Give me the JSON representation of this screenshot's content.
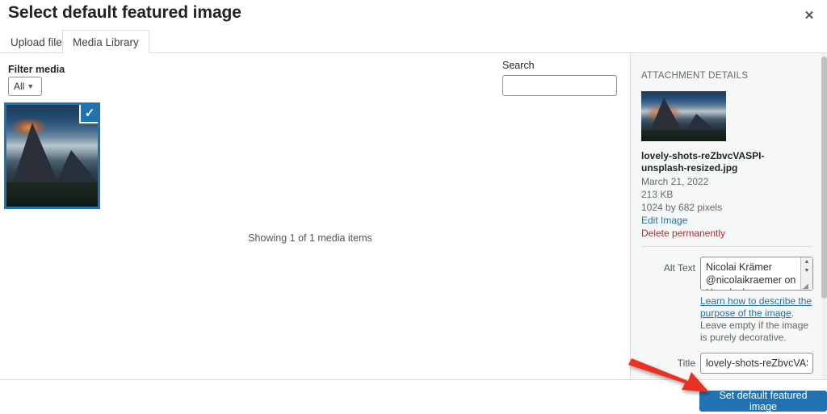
{
  "modal": {
    "title": "Select default featured image",
    "close_icon": "close-icon"
  },
  "tabs": [
    {
      "label": "Upload files",
      "active": false
    },
    {
      "label": "Media Library",
      "active": true
    }
  ],
  "toolbar": {
    "filter_label": "Filter media",
    "filter_value": "All",
    "filter_options": [
      "All"
    ],
    "search_label": "Search",
    "search_value": "",
    "search_placeholder": ""
  },
  "grid": {
    "status_text": "Showing 1 of 1 media items",
    "item": {
      "selected": true,
      "check_icon": "check-icon"
    }
  },
  "sidebar": {
    "heading": "ATTACHMENT DETAILS",
    "filename": "lovely-shots-reZbvcVASPI-unsplash-resized.jpg",
    "date": "March 21, 2022",
    "filesize": "213 KB",
    "dimensions": "1024 by 682 pixels",
    "edit_link": "Edit Image",
    "delete_link": "Delete permanently",
    "alt_text_label": "Alt Text",
    "alt_text_value": "Nicolai Krämer @nicolaikraemer on Unsplash",
    "alt_help_link": "Learn how to describe the purpose of the image",
    "alt_help_rest": ". Leave empty if the image is purely decorative.",
    "title_label": "Title",
    "title_value": "lovely-shots-reZbvcVASPI"
  },
  "footer": {
    "primary_button": "Set default featured image"
  },
  "colors": {
    "accent": "#2271b1",
    "danger": "#b32d2e",
    "annotation": "#ea3323",
    "sidebar_bg": "#f6f7f7",
    "border": "#dcdcde"
  }
}
